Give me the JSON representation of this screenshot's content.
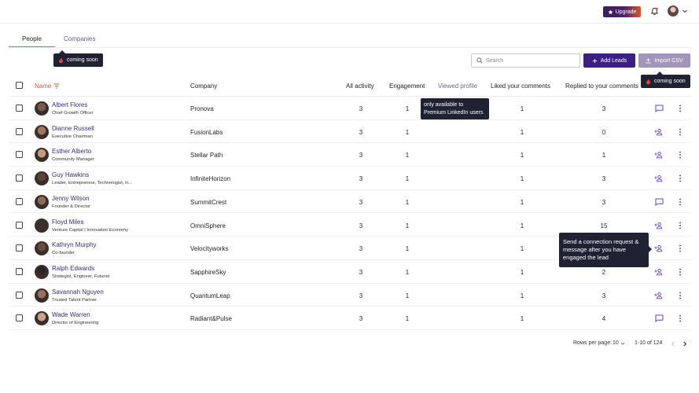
{
  "header": {
    "upgrade_label": "Upgrade",
    "icons": [
      "star-icon",
      "bell-icon",
      "user-avatar",
      "chevron-down-icon"
    ]
  },
  "tabs": [
    {
      "label": "People",
      "active": true
    },
    {
      "label": "Companies",
      "active": false
    }
  ],
  "tooltips": {
    "companies_tip": "coming soon",
    "import_tip": "coming soon",
    "viewed_profile_tip": "only available to Premium LinkedIn users",
    "connect_tip": "Send a connection request & message after you have engaged the lead"
  },
  "toolbar": {
    "search_placeholder": "Search",
    "add_leads_label": "Add Leads",
    "import_csv_label": "Import CSV"
  },
  "table": {
    "columns": {
      "name": "Name",
      "company": "Company",
      "all_activity": "All activity",
      "engagement": "Engagement",
      "viewed_profile": "Viewed profile",
      "liked_comments": "Liked your comments",
      "replied_comments": "Replied to your comments"
    },
    "rows": [
      {
        "name": "Albert Flores",
        "title": "Chief Growth Officer",
        "company": "Pronova",
        "all_activity": "3",
        "engagement": "1",
        "liked": "1",
        "replied": "3",
        "action": "message"
      },
      {
        "name": "Dianne Russell",
        "title": "Executive Chairman",
        "company": "FusionLabs",
        "all_activity": "3",
        "engagement": "1",
        "liked": "1",
        "replied": "0",
        "action": "connect"
      },
      {
        "name": "Esther Alberto",
        "title": "Community Manager",
        "company": "Stellar Path",
        "all_activity": "3",
        "engagement": "1",
        "liked": "1",
        "replied": "1",
        "action": "connect"
      },
      {
        "name": "Guy Hawkins",
        "title": "Leader, Entrepreneur, Technologist, in...",
        "company": "InfiniteHorizon",
        "all_activity": "3",
        "engagement": "1",
        "liked": "1",
        "replied": "3",
        "action": "connect"
      },
      {
        "name": "Jenny Wilson",
        "title": "Founder & Director",
        "company": "SummitCrest",
        "all_activity": "3",
        "engagement": "1",
        "liked": "1",
        "replied": "3",
        "action": "message"
      },
      {
        "name": "Floyd Miles",
        "title": "Venture Capital | Innovation Economy",
        "company": "OmniSphere",
        "all_activity": "3",
        "engagement": "1",
        "liked": "1",
        "replied": "15",
        "action": "connect"
      },
      {
        "name": "Kathryn Murphy",
        "title": "Co-founder",
        "company": "Velocityworks",
        "all_activity": "3",
        "engagement": "1",
        "liked": "1",
        "replied": "",
        "action": "connect"
      },
      {
        "name": "Ralph Edwards",
        "title": "Strategist, Engineer, Futurist",
        "company": "SapphireSky",
        "all_activity": "3",
        "engagement": "1",
        "liked": "1",
        "replied": "2",
        "action": "connect"
      },
      {
        "name": "Savannah Nguyen",
        "title": "Trusted Talent Partner",
        "company": "QuantumLeap",
        "all_activity": "3",
        "engagement": "1",
        "liked": "1",
        "replied": "3",
        "action": "connect"
      },
      {
        "name": "Wade Warren",
        "title": "Director of Engineering",
        "company": "Radiant&Pulse",
        "all_activity": "3",
        "engagement": "1",
        "liked": "1",
        "replied": "4",
        "action": "message"
      }
    ]
  },
  "pagination": {
    "rows_per_page_label": "Rows per page:",
    "rows_per_page_value": "10",
    "range_label": "1-10 of 124"
  },
  "colors": {
    "accent": "#3b2080",
    "sort_accent": "#d9562b",
    "tooltip_bg": "#1f2233",
    "icon_purple": "#6a3fc0"
  }
}
